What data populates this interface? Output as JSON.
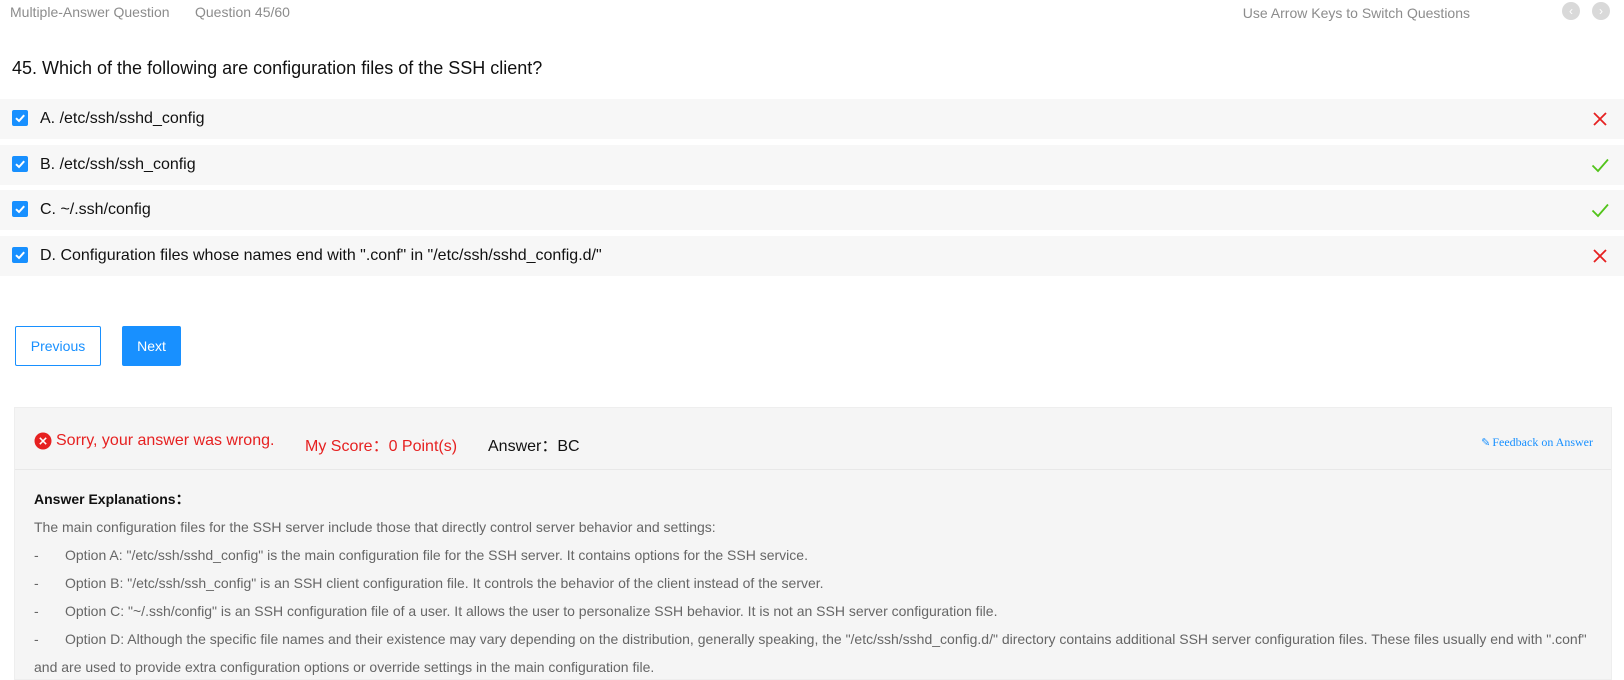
{
  "topbar": {
    "question_type": "Multiple-Answer Question",
    "question_count": "Question 45/60",
    "hint": "Use Arrow Keys to Switch Questions",
    "prev_icon": "chevron-left-icon",
    "next_icon": "chevron-right-icon"
  },
  "question": {
    "text": "45. Which of the following are configuration files of the SSH client?"
  },
  "options": [
    {
      "label": "A. /etc/ssh/sshd_config",
      "checked": true,
      "result": "wrong"
    },
    {
      "label": "B. /etc/ssh/ssh_config",
      "checked": true,
      "result": "correct"
    },
    {
      "label": "C. ~/.ssh/config",
      "checked": true,
      "result": "correct"
    },
    {
      "label": "D. Configuration files whose names end with \".conf\" in \"/etc/ssh/sshd_config.d/\"",
      "checked": true,
      "result": "wrong"
    }
  ],
  "buttons": {
    "previous": "Previous",
    "next": "Next"
  },
  "result": {
    "wrong_text": "Sorry, your answer was wrong.",
    "score_text": "My Score：0 Point(s)",
    "answer_text": "Answer：BC",
    "feedback_text": "Feedback on Answer"
  },
  "explanation": {
    "title": "Answer Explanations：",
    "intro": "The main configuration files for the SSH server include those that directly control server behavior and settings:",
    "items": [
      "Option A: \"/etc/ssh/sshd_config\" is the main configuration file for the SSH server. It contains options for the SSH service.",
      "Option B: \"/etc/ssh/ssh_config\" is an SSH client configuration file. It controls the behavior of the client instead of the server.",
      "Option C: \"~/.ssh/config\" is an SSH configuration file of a user. It allows the user to personalize SSH behavior. It is not an SSH server configuration file.",
      "Option D: Although the specific file names and their existence may vary depending on the distribution, generally speaking, the \"/etc/ssh/sshd_config.d/\" directory contains additional SSH server configuration files. These files usually end with \".conf\" and are used to provide extra configuration options or override settings in the main configuration file."
    ],
    "bullet": "-"
  },
  "colors": {
    "accent": "#1890ff",
    "wrong": "#e62121",
    "correct": "#52c41a"
  }
}
